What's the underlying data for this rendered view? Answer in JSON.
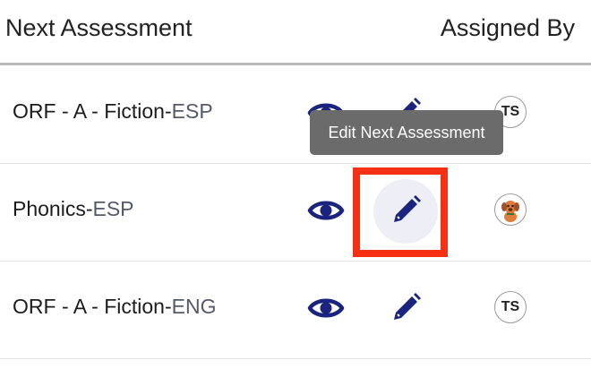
{
  "header": {
    "title": "Next Assessment",
    "assigned_by": "Assigned By"
  },
  "rows": [
    {
      "name": "ORF - A - Fiction-",
      "lang": "ESP",
      "avatar": "TS",
      "avatar_type": "initials"
    },
    {
      "name": "Phonics-",
      "lang": "ESP",
      "avatar": "",
      "avatar_type": "dog-image"
    },
    {
      "name": "ORF - A - Fiction-",
      "lang": "ENG",
      "avatar": "TS",
      "avatar_type": "initials"
    }
  ],
  "tooltip": {
    "text": "Edit Next Assessment"
  },
  "icons": {
    "view": "eye-icon",
    "edit": "pencil-icon"
  },
  "colors": {
    "icon": "#1a237e",
    "highlight": "#f53014",
    "tooltip_bg": "#6b6b6b",
    "hover_bg": "#eeeef6"
  }
}
